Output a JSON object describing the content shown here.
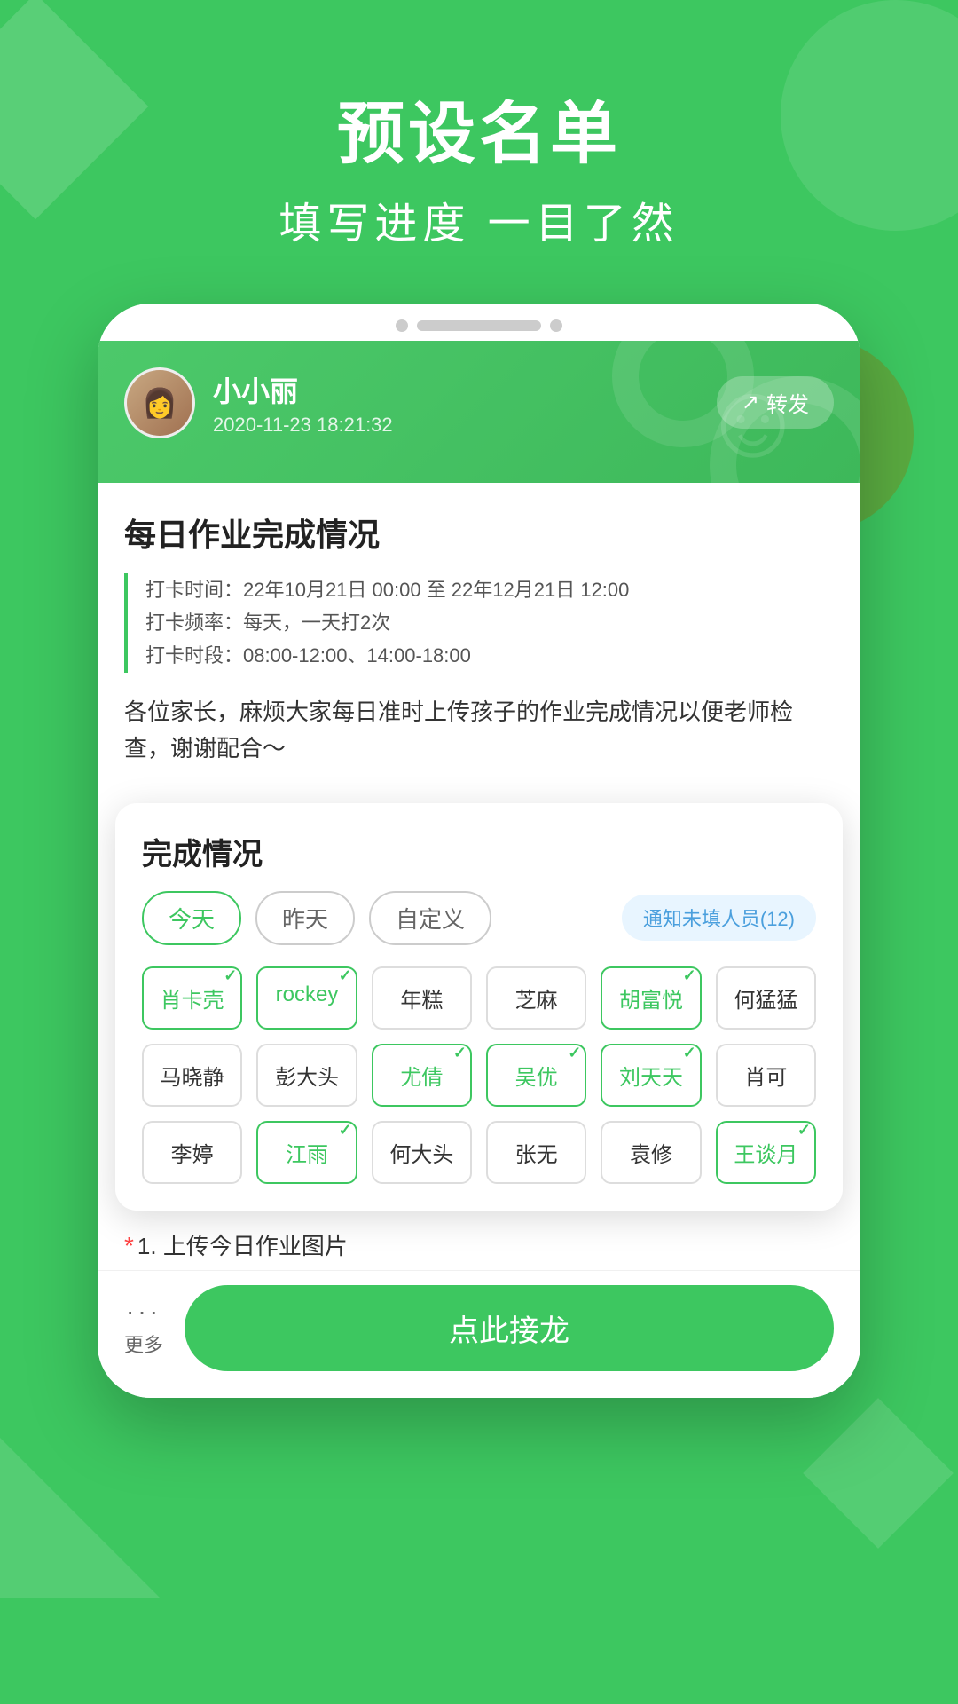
{
  "header": {
    "title": "预设名单",
    "subtitle": "填写进度 一目了然"
  },
  "card": {
    "user": {
      "name": "小小丽",
      "time": "2020-11-23 18:21:32",
      "avatar_emoji": "👩"
    },
    "forward_label": "转发",
    "content_title": "每日作业完成情况",
    "info_lines": [
      "打卡时间：22年10月21日 00:00 至 22年12月21日 12:00",
      "打卡频率：每天，一天打2次",
      "打卡时段：08:00-12:00、14:00-18:00"
    ],
    "description": "各位家长，麻烦大家每日准时上传孩子的作业完成情况以便老师检查，谢谢配合～"
  },
  "status": {
    "title": "完成情况",
    "filters": [
      {
        "label": "今天",
        "active": true
      },
      {
        "label": "昨天",
        "active": false
      },
      {
        "label": "自定义",
        "active": false
      }
    ],
    "notify_btn": "通知未填人员(12)",
    "names": [
      {
        "name": "肖卡壳",
        "checked": true
      },
      {
        "name": "rockey",
        "checked": true
      },
      {
        "name": "年糕",
        "checked": false
      },
      {
        "name": "芝麻",
        "checked": false
      },
      {
        "name": "胡富悦",
        "checked": true
      },
      {
        "name": "何猛猛",
        "checked": false
      },
      {
        "name": "马晓静",
        "checked": false
      },
      {
        "name": "彭大头",
        "checked": false
      },
      {
        "name": "尤倩",
        "checked": true
      },
      {
        "name": "吴优",
        "checked": true
      },
      {
        "name": "刘天天",
        "checked": true
      },
      {
        "name": "肖可",
        "checked": false
      },
      {
        "name": "李婷",
        "checked": false
      },
      {
        "name": "江雨",
        "checked": true
      },
      {
        "name": "何大头",
        "checked": false
      },
      {
        "name": "张无",
        "checked": false
      },
      {
        "name": "袁修",
        "checked": false
      },
      {
        "name": "王谈月",
        "checked": true
      }
    ]
  },
  "required_field": "1. 上传今日作业图片",
  "bottom": {
    "more_dots": "···",
    "more_label": "更多",
    "submit_label": "点此接龙"
  }
}
